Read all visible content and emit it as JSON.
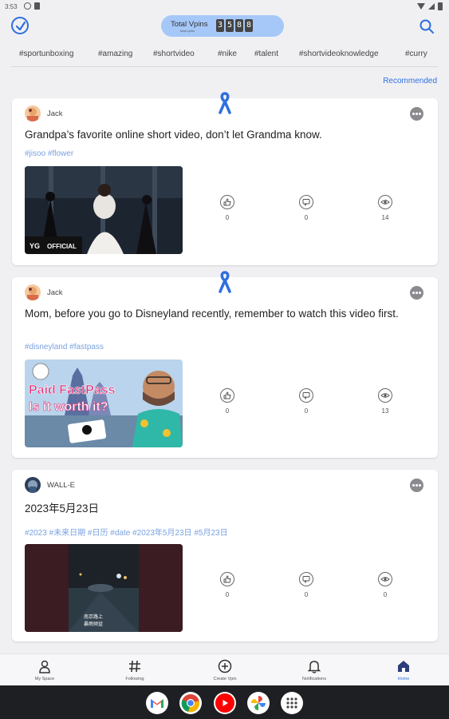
{
  "status_bar": {
    "time": "3:53"
  },
  "header": {
    "vpins_label": "Total Vpins",
    "vpins_sublabel": "total vpins",
    "vpins_digits": [
      "3",
      "5",
      "8",
      "8"
    ]
  },
  "tags": [
    "#sportunboxing",
    "#amazing",
    "#shortvideo",
    "#nike",
    "#talent",
    "#shortvideoknowledge",
    "#curry"
  ],
  "recommended_label": "Recommended",
  "posts": [
    {
      "author": "Jack",
      "text": "Grandpa’s favorite online short video, don’t let Grandma know.",
      "tags": "#jisoo #flower",
      "thumb_caption": "OFFICIAL",
      "likes": "0",
      "comments": "0",
      "views": "14"
    },
    {
      "author": "Jack",
      "text": "Mom, before you go to Disneyland recently, remember to watch this video first.",
      "tags": "#disneyland #fastpass",
      "thumb_line1": "Paid FastPass",
      "thumb_line2": "Is it worth it?",
      "likes": "0",
      "comments": "0",
      "views": "13"
    },
    {
      "author": "WALL-E",
      "text": "2023年5月23日",
      "tags": "#2023 #未来日期 #日历 #date #2023年5月23日 #5月23日",
      "thumb_sub1": "南京路上",
      "thumb_sub2": "暴雨倾盆",
      "likes": "0",
      "comments": "0",
      "views": "0"
    }
  ],
  "bottom_nav": [
    {
      "label": "My Space",
      "icon": "person-icon"
    },
    {
      "label": "Following",
      "icon": "hashtag-icon"
    },
    {
      "label": "Create Vpin",
      "icon": "plus-circle-icon"
    },
    {
      "label": "Notifications",
      "icon": "bell-icon"
    },
    {
      "label": "Home",
      "icon": "home-icon",
      "active": true
    }
  ],
  "dock_apps": [
    "gmail-icon",
    "chrome-icon",
    "youtube-icon",
    "photos-icon",
    "app-drawer-icon"
  ],
  "colors": {
    "accent": "#2f6fde",
    "pill": "#a5c8f8",
    "tag_link": "#7aa2e0",
    "background": "#f0f0f3"
  }
}
